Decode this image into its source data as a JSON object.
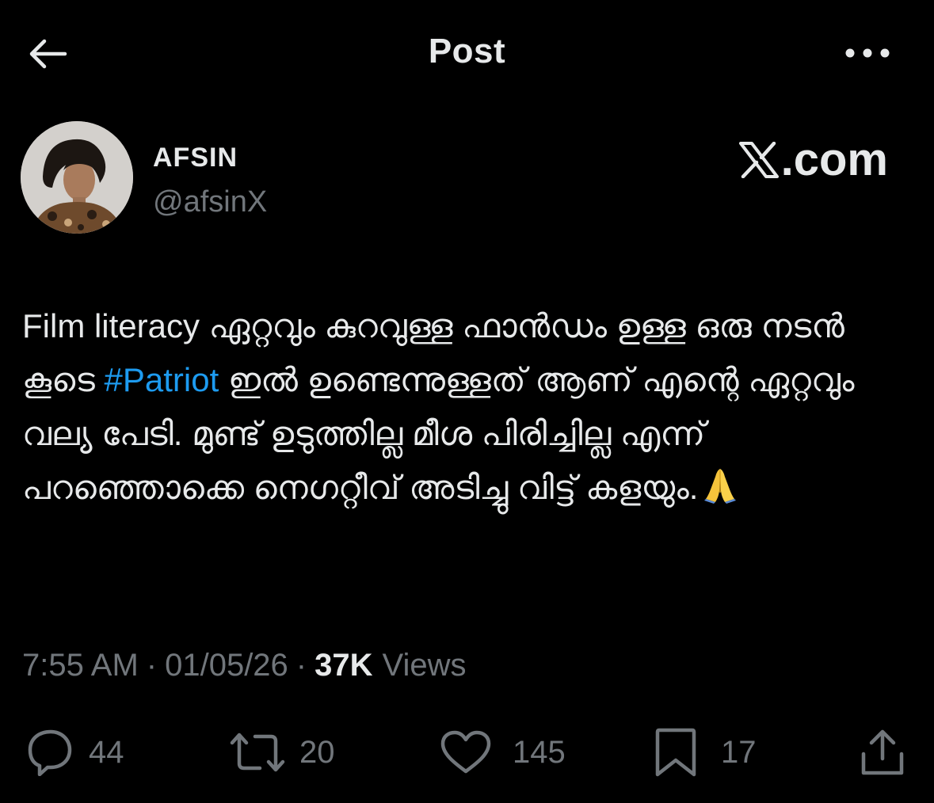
{
  "header": {
    "title": "Post",
    "back_icon": "arrow-left-icon",
    "more_icon": "ellipsis-icon"
  },
  "author": {
    "name": "AFSIN",
    "handle": "@afsinX"
  },
  "watermark": {
    "text": ".com",
    "logo": "x-logo-icon"
  },
  "post": {
    "text_before": "Film literacy ഏറ്റവും കുറവുള്ള ഫാൻഡം ഉള്ള ഒരു നടൻ കൂടെ ",
    "hashtag": "#Patriot",
    "text_after": " ഇൽ ഉണ്ടെന്നുള്ളത് ആണ് എന്റെ ഏറ്റവും വല്യ പേടി. മുണ്ട് ഉടുത്തില്ല മീശ പിരിച്ചില്ല എന്ന് പറഞ്ഞൊക്കെ നെഗറ്റീവ് അടിച്ചു വിട്ട്  കളയും.",
    "emoji": "folded-hands"
  },
  "meta": {
    "time": "7:55 AM",
    "separator": "·",
    "date": "01/05/26",
    "views_count": "37K",
    "views_label": "Views"
  },
  "actions": {
    "replies": "44",
    "reposts": "20",
    "likes": "145",
    "bookmarks": "17"
  },
  "colors": {
    "background": "#000000",
    "text": "#e7e9ea",
    "muted": "#71767b",
    "link": "#1d9bf0"
  }
}
